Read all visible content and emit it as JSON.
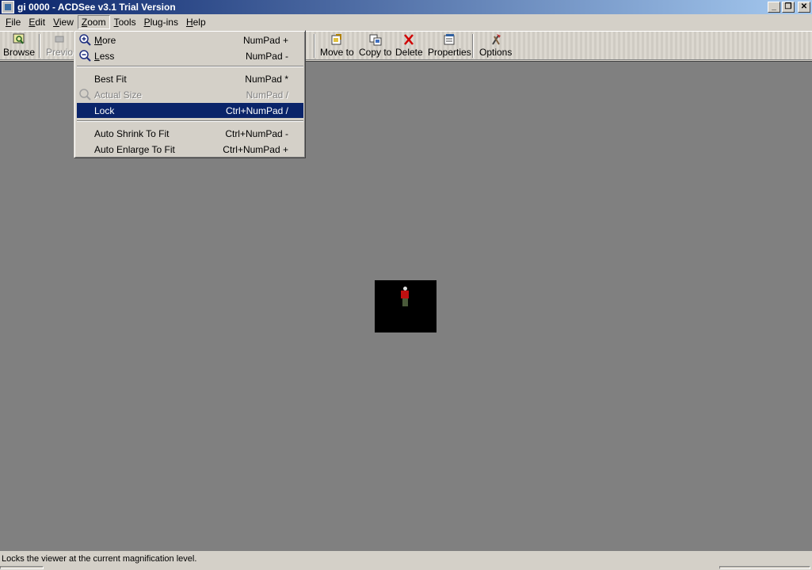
{
  "window": {
    "title": "gi 0000 - ACDSee v3.1 Trial Version",
    "minimize": "_",
    "restore": "❐",
    "close": "✕"
  },
  "menubar": [
    {
      "prefix": "",
      "ul": "F",
      "rest": "ile"
    },
    {
      "prefix": "",
      "ul": "E",
      "rest": "dit"
    },
    {
      "prefix": "",
      "ul": "V",
      "rest": "iew"
    },
    {
      "prefix": "",
      "ul": "Z",
      "rest": "oom"
    },
    {
      "prefix": "",
      "ul": "T",
      "rest": "ools"
    },
    {
      "prefix": "",
      "ul": "P",
      "rest": "lug-ins"
    },
    {
      "prefix": "",
      "ul": "H",
      "rest": "elp"
    }
  ],
  "toolbar": {
    "browse": "Browse",
    "previous": "Previo",
    "move_to": "Move to",
    "copy_to": "Copy to",
    "delete": "Delete",
    "properties": "Properties",
    "options": "Options"
  },
  "zoom_menu": {
    "items": [
      {
        "label": "More",
        "ul": "M",
        "shortcut": "NumPad +",
        "icon": "zoom-in-icon"
      },
      {
        "label": "Less",
        "ul": "L",
        "shortcut": "NumPad -",
        "icon": "zoom-out-icon"
      },
      {
        "label": "Best Fit",
        "shortcut": "NumPad *"
      },
      {
        "label": "Actual Size",
        "shortcut": "NumPad /",
        "icon": "zoom-icon",
        "disabled": true
      },
      {
        "label": "Lock",
        "shortcut": "Ctrl+NumPad /",
        "highlighted": true
      },
      {
        "label": "Auto Shrink To Fit",
        "shortcut": "Ctrl+NumPad -"
      },
      {
        "label": "Auto Enlarge To Fit",
        "shortcut": "Ctrl+NumPad +"
      }
    ]
  },
  "status": {
    "text": "Locks the viewer at the current magnification level."
  },
  "colors": {
    "highlight": "#0a246a",
    "viewer_bg": "#808080"
  }
}
